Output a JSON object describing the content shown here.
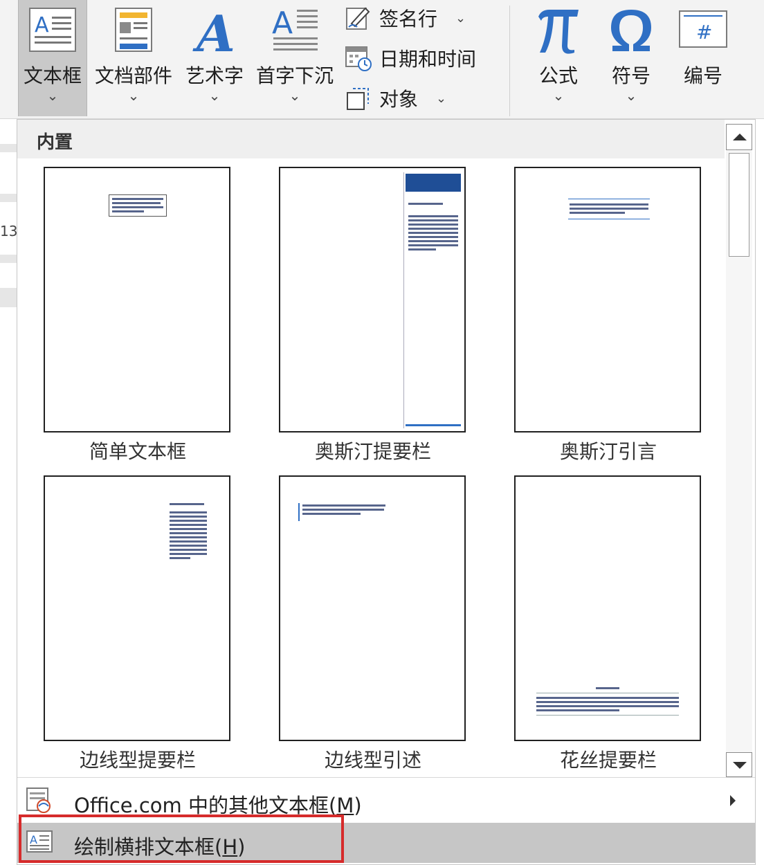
{
  "ribbon": {
    "textbox": {
      "label": "文本框",
      "icon": "textbox-icon"
    },
    "quickparts": {
      "label": "文档部件",
      "icon": "quick-parts-icon"
    },
    "wordart": {
      "label": "艺术字",
      "icon": "wordart-icon"
    },
    "dropcap": {
      "label": "首字下沉",
      "icon": "drop-cap-icon"
    },
    "signature_line": {
      "label": "签名行",
      "icon": "signature-line-icon"
    },
    "date_time": {
      "label": "日期和时间",
      "icon": "date-time-icon"
    },
    "object": {
      "label": "对象",
      "icon": "object-icon"
    },
    "equation": {
      "label": "公式",
      "icon": "pi-icon"
    },
    "symbol": {
      "label": "符号",
      "icon": "omega-icon"
    },
    "number": {
      "label": "编号",
      "icon": "number-icon"
    },
    "chevron": "⌄"
  },
  "document": {
    "ruler_number": "13"
  },
  "gallery": {
    "section_title": "内置",
    "items": [
      {
        "caption": "简单文本框"
      },
      {
        "caption": "奥斯汀提要栏"
      },
      {
        "caption": "奥斯汀引言"
      },
      {
        "caption": "边线型提要栏"
      },
      {
        "caption": "边线型引述"
      },
      {
        "caption": "花丝提要栏"
      }
    ]
  },
  "menu": {
    "office_more": {
      "label_pre": "Office.com 中的其他文本框(",
      "key": "M",
      "label_post": ")",
      "icon": "office-textbox-icon"
    },
    "draw_textbox": {
      "label_pre": "绘制横排文本框(",
      "key": "H",
      "label_post": ")",
      "icon": "draw-textbox-icon"
    }
  },
  "colors": {
    "accent_blue": "#2f6fc4",
    "dark_blue": "#1f4e96",
    "highlight_red": "#d62b2b",
    "selected_gray": "#c6c6c6"
  }
}
